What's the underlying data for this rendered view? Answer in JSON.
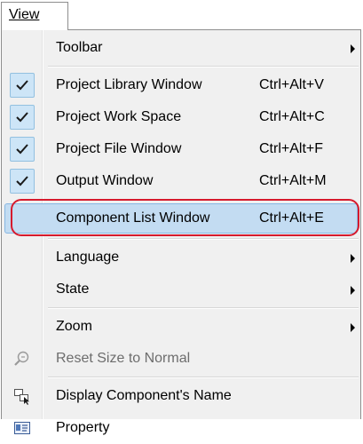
{
  "menu": {
    "title": "View"
  },
  "items": [
    {
      "label": "Toolbar",
      "shortcut": "",
      "checked": false,
      "submenu": true
    },
    {
      "label": "Project Library Window",
      "shortcut": "Ctrl+Alt+V",
      "checked": true
    },
    {
      "label": "Project Work Space",
      "shortcut": "Ctrl+Alt+C",
      "checked": true
    },
    {
      "label": "Project File Window",
      "shortcut": "Ctrl+Alt+F",
      "checked": true
    },
    {
      "label": "Output Window",
      "shortcut": "Ctrl+Alt+M",
      "checked": true
    },
    {
      "label": "Component List Window",
      "shortcut": "Ctrl+Alt+E",
      "checked": false,
      "highlighted": true
    },
    {
      "label": "Language",
      "shortcut": "",
      "submenu": true
    },
    {
      "label": "State",
      "shortcut": "",
      "submenu": true
    },
    {
      "label": "Zoom",
      "shortcut": "",
      "submenu": true
    },
    {
      "label": "Reset Size to Normal",
      "shortcut": "",
      "disabled": true,
      "icon": "magnifier-reset-icon"
    },
    {
      "label": "Display Component's Name",
      "shortcut": "",
      "icon": "component-name-icon"
    },
    {
      "label": "Property",
      "shortcut": "",
      "icon": "property-icon"
    }
  ],
  "colors": {
    "check_bg": "#cde5f7",
    "highlight_bg": "#c3dcf2",
    "callout_ring": "#d61a2d"
  }
}
